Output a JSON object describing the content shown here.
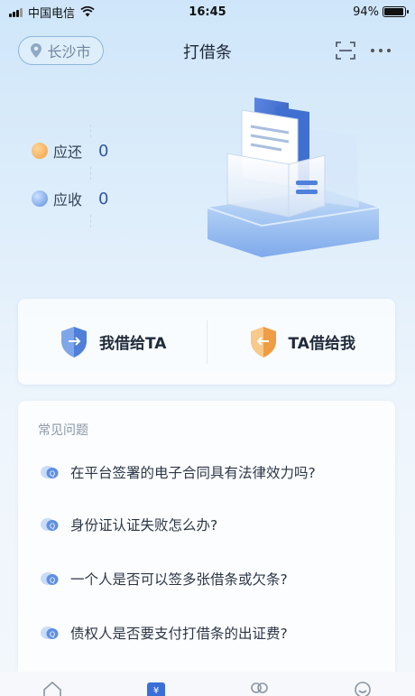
{
  "status_bar": {
    "carrier": "中国电信",
    "time": "16:45",
    "battery": "94%",
    "battery_level": 0.94
  },
  "header": {
    "city": "长沙市",
    "title": "打借条",
    "icons": [
      "location-pin-icon",
      "scan-icon",
      "more-icon"
    ]
  },
  "summary": {
    "payable_label": "应还",
    "payable_value": "0",
    "receivable_label": "应收",
    "receivable_value": "0"
  },
  "lend": {
    "lend_to_them": "我借给TA",
    "borrow_from_them": "TA借给我"
  },
  "faq": {
    "title": "常见问题",
    "items": [
      "在平台签署的电子合同具有法律效力吗?",
      "身份证认证失败怎么办?",
      "一个人是否可以签多张借条或欠条?",
      "债权人是否要支付打借条的出证费?"
    ]
  },
  "tabbar": {
    "icons": [
      "home-icon",
      "iou-icon",
      "contacts-icon",
      "profile-icon"
    ],
    "active": 1
  },
  "colors": {
    "accent": "#3b6fd8",
    "value_blue": "#2f57a7",
    "orange": "#f0a040"
  }
}
